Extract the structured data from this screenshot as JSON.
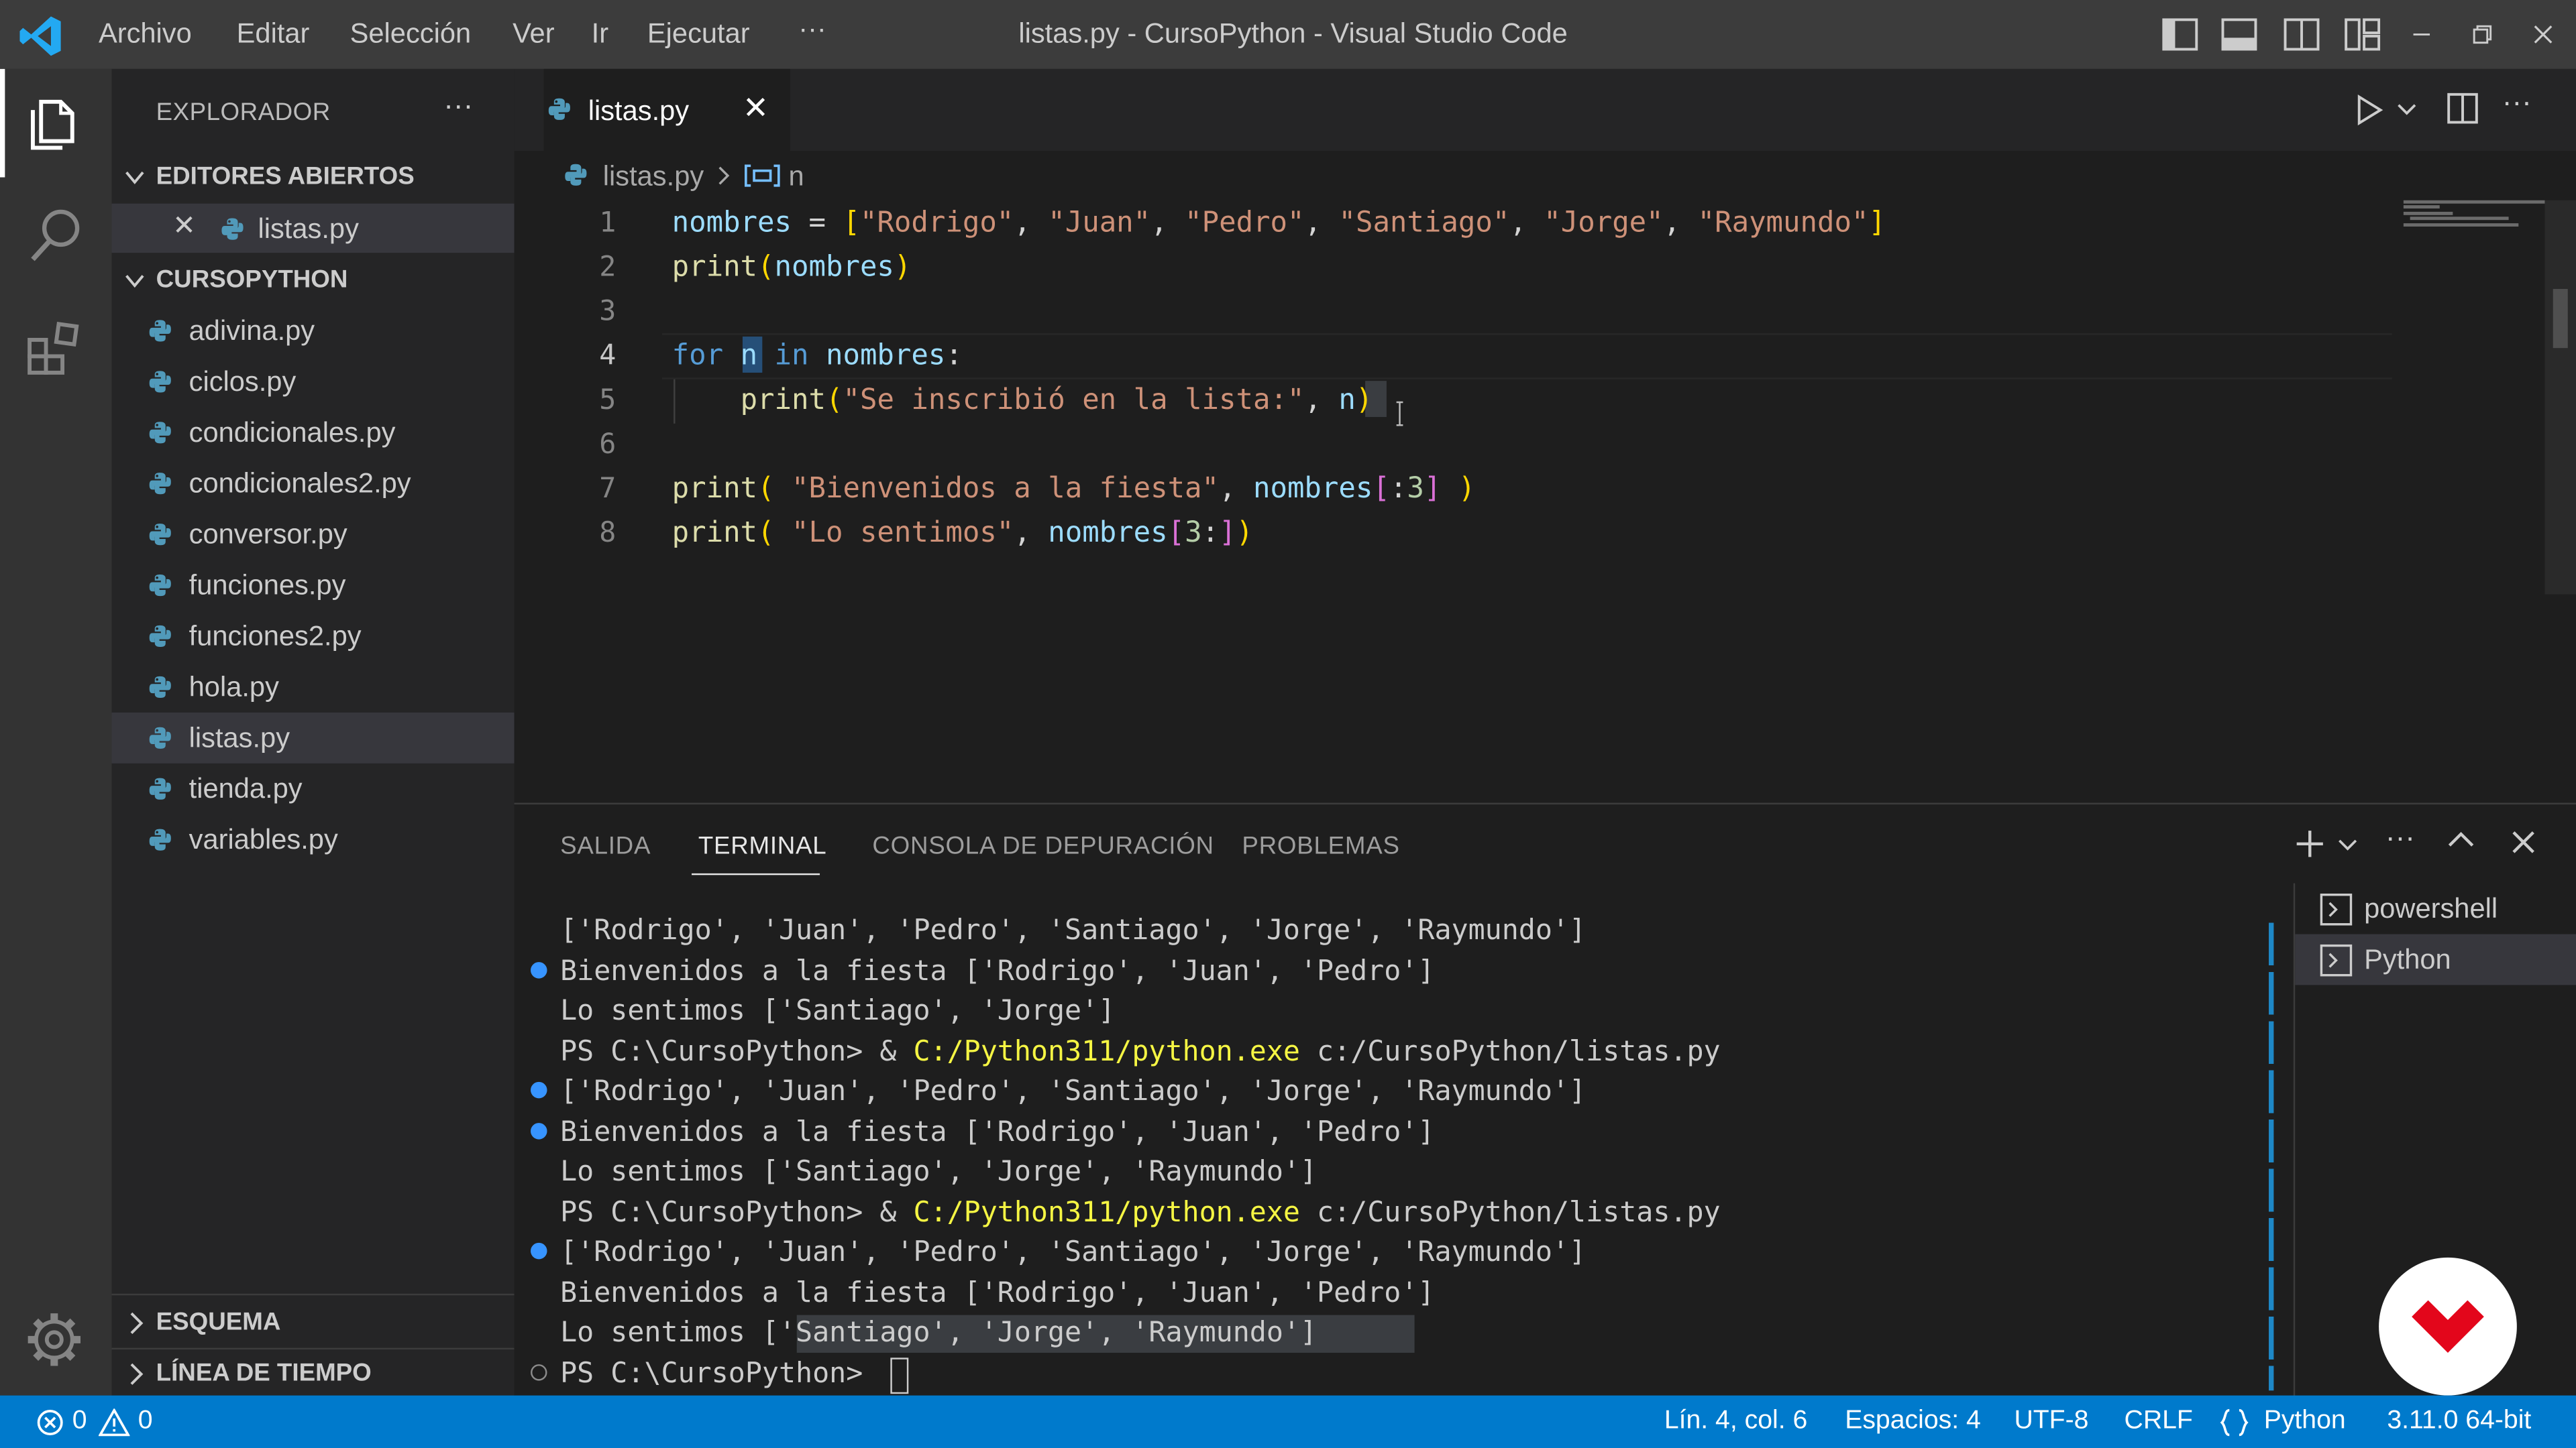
{
  "titlebar": {
    "menu": [
      "Archivo",
      "Editar",
      "Selección",
      "Ver",
      "Ir",
      "Ejecutar",
      "···"
    ],
    "title": "listas.py - CursoPython - Visual Studio Code"
  },
  "sidebar": {
    "title": "EXPLORADOR",
    "more": "···",
    "open_editors_header": "EDITORES ABIERTOS",
    "open_editors": [
      {
        "close": "✕",
        "name": "listas.py"
      }
    ],
    "folder_header": "CURSOPYTHON",
    "files": [
      "adivina.py",
      "ciclos.py",
      "condicionales.py",
      "condicionales2.py",
      "conversor.py",
      "funciones.py",
      "funciones2.py",
      "hola.py",
      "listas.py",
      "tienda.py",
      "variables.py"
    ],
    "selected_file": "listas.py",
    "outline_header": "ESQUEMA",
    "timeline_header": "LÍNEA DE TIEMPO"
  },
  "editor": {
    "tab_label": "listas.py",
    "tab_close": "✕",
    "breadcrumb": {
      "file": "listas.py",
      "symbol": "n"
    },
    "line_numbers": [
      "1",
      "2",
      "3",
      "4",
      "5",
      "6",
      "7",
      "8"
    ],
    "current_line": "4",
    "code": [
      "nombres = [\"Rodrigo\", \"Juan\", \"Pedro\", \"Santiago\", \"Jorge\", \"Raymundo\"]",
      "print(nombres)",
      "",
      "for n in nombres:",
      "    print(\"Se inscribió en la lista:\", n)",
      "",
      "print( \"Bienvenidos a la fiesta\", nombres[:3] )",
      "print( \"Lo sentimos\", nombres[3:])"
    ]
  },
  "panel": {
    "tabs": [
      "SALIDA",
      "TERMINAL",
      "CONSOLA DE DEPURACIÓN",
      "PROBLEMAS"
    ],
    "active_tab": "TERMINAL",
    "terminals": [
      "powershell",
      "Python"
    ],
    "active_terminal": "Python",
    "terminal_lines": [
      "['Rodrigo', 'Juan', 'Pedro', 'Santiago', 'Jorge', 'Raymundo']",
      "Bienvenidos a la fiesta ['Rodrigo', 'Juan', 'Pedro']",
      "Lo sentimos ['Santiago', 'Jorge']",
      "PS C:\\CursoPython> & ",
      "['Rodrigo', 'Juan', 'Pedro', 'Santiago', 'Jorge', 'Raymundo']",
      "Bienvenidos a la fiesta ['Rodrigo', 'Juan', 'Pedro']",
      "Lo sentimos ['Santiago', 'Jorge', 'Raymundo']",
      "PS C:\\CursoPython> & ",
      "['Rodrigo', 'Juan', 'Pedro', 'Santiago', 'Jorge', 'Raymundo']",
      "Bienvenidos a la fiesta ['Rodrigo', 'Juan', 'Pedro']",
      "Lo sentimos ['Santiago', 'Jorge', 'Raymundo']",
      "PS C:\\CursoPython> "
    ],
    "python_exe": "C:/Python311/python.exe",
    "script_path": " c:/CursoPython/listas.py"
  },
  "statusbar": {
    "errors": "0",
    "warnings": "0",
    "position": "Lín. 4, col. 6",
    "spaces": "Espacios: 4",
    "encoding": "UTF-8",
    "eol": "CRLF",
    "language": "Python",
    "interpreter": "3.11.0 64-bit"
  },
  "colors": {
    "accent": "#007acc",
    "keyword": "#569cd6",
    "string": "#ce9178",
    "function": "#dcdcaa",
    "variable": "#9cdcfe",
    "bracket": "#ffd700",
    "logo": "#e3061b"
  }
}
